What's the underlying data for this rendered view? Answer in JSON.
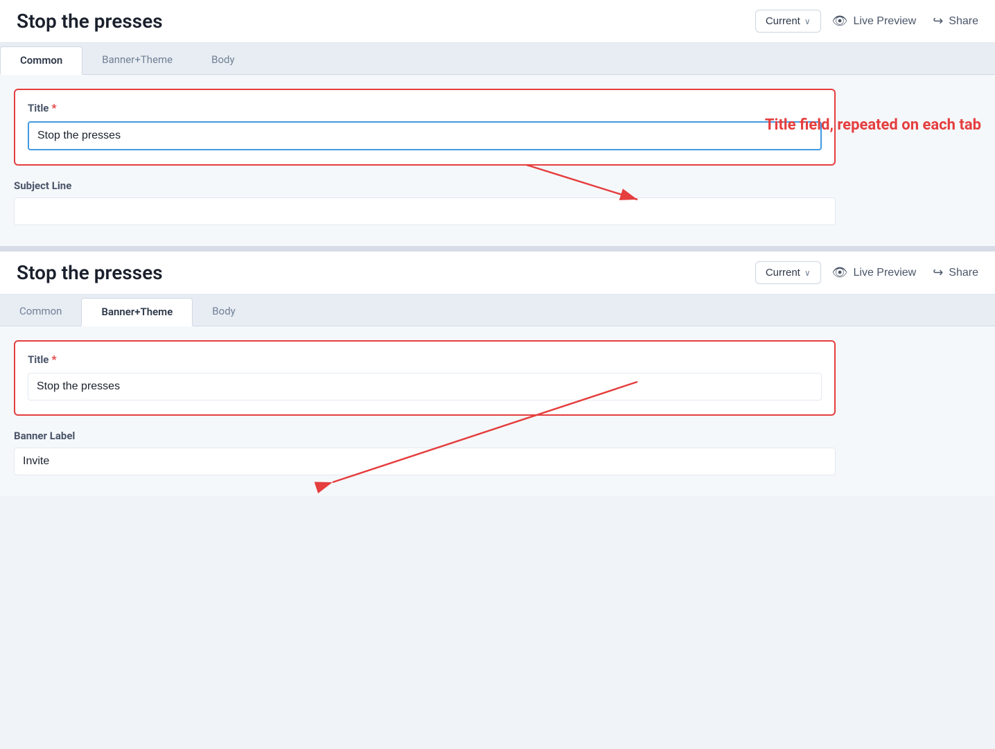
{
  "page": {
    "title": "Stop the presses"
  },
  "panel1": {
    "header": {
      "title": "Stop the presses",
      "dropdown_label": "Current",
      "live_preview_label": "Live Preview",
      "share_label": "Share"
    },
    "tabs": [
      {
        "id": "common",
        "label": "Common",
        "active": true
      },
      {
        "id": "banner-theme",
        "label": "Banner+Theme",
        "active": false
      },
      {
        "id": "body",
        "label": "Body",
        "active": false
      }
    ],
    "form": {
      "title_label": "Title",
      "title_required": true,
      "title_value": "Stop the presses",
      "subject_line_label": "Subject Line",
      "subject_line_value": ""
    }
  },
  "panel2": {
    "header": {
      "title": "Stop the presses",
      "dropdown_label": "Current",
      "live_preview_label": "Live Preview",
      "share_label": "Share"
    },
    "tabs": [
      {
        "id": "common",
        "label": "Common",
        "active": false
      },
      {
        "id": "banner-theme",
        "label": "Banner+Theme",
        "active": true
      },
      {
        "id": "body",
        "label": "Body",
        "active": false
      }
    ],
    "form": {
      "title_label": "Title",
      "title_required": true,
      "title_value": "Stop the presses",
      "banner_label_label": "Banner Label",
      "banner_label_value": "Invite"
    }
  },
  "annotation": {
    "text": "Title field, repeated on each tab"
  },
  "icons": {
    "eye": "👁",
    "share": "↪",
    "chevron": "∨"
  }
}
